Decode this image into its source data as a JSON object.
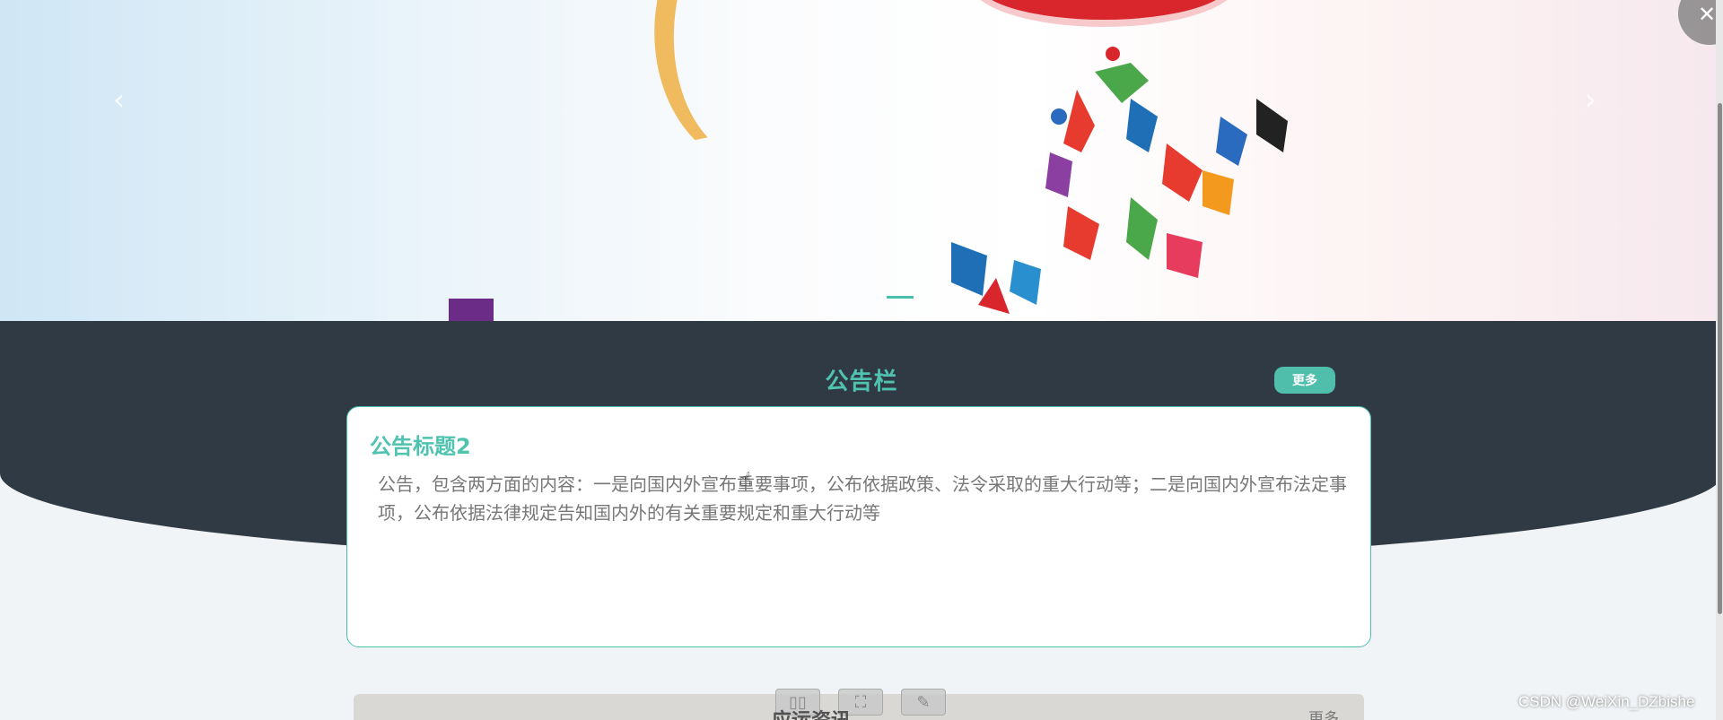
{
  "banner": {
    "prev_arrow": "‹",
    "next_arrow": "›",
    "colors": {
      "indicator": "#4bbfae",
      "ball": "#d8262c",
      "arc": "#f0b044"
    }
  },
  "notice": {
    "title": "公告栏",
    "more_label": "更多",
    "card_title": "公告标题2",
    "card_body": "公告，包含两方面的内容：一是向国内外宣布重要事项，公布依据政策、法令采取的重大行动等；二是向国内外宣布法定事项，公布依据法律规定告知国内外的有关重要规定和重大行动等",
    "colors": {
      "accent": "#4fc3b0",
      "dark_bg": "#303a44"
    }
  },
  "next_section": {
    "title": "应运资讯",
    "more_label": "更多"
  },
  "close_glyph": "✕",
  "watermark": "CSDN @WeiXin_DZbishe"
}
